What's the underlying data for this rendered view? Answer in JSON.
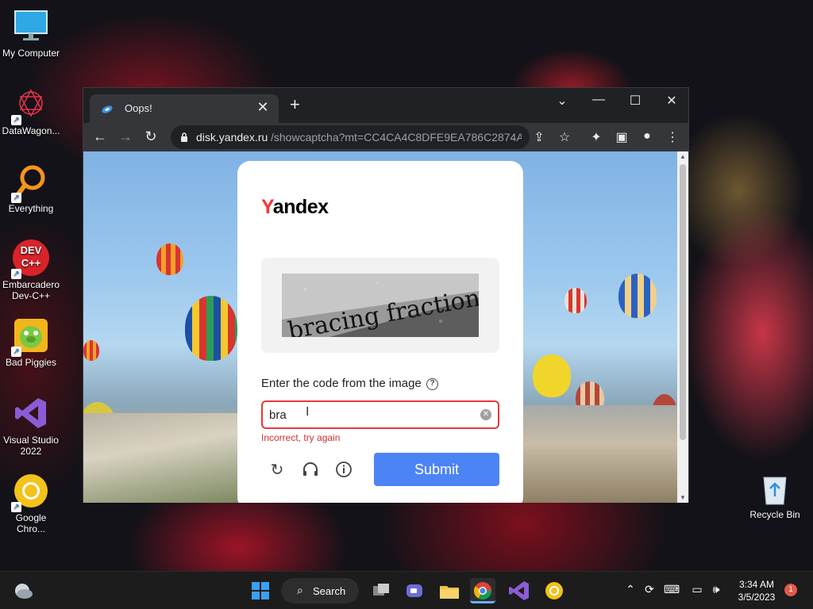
{
  "desktop_icons": [
    {
      "label": "My Computer",
      "icon": "monitor-icon"
    },
    {
      "label": "DataWagon...",
      "icon": "datawagon-icon"
    },
    {
      "label": "Everything",
      "icon": "everything-search-icon"
    },
    {
      "label": "Embarcadero Dev-C++",
      "icon": "devcpp-icon",
      "badge": "DEV C++"
    },
    {
      "label": "Bad Piggies",
      "icon": "bad-piggies-icon"
    },
    {
      "label": "Visual Studio 2022",
      "icon": "visual-studio-icon"
    },
    {
      "label": "Google Chro...",
      "icon": "chrome-icon"
    }
  ],
  "recycle_bin": {
    "label": "Recycle Bin"
  },
  "browser": {
    "tab_title": "Oops!",
    "tab_close": "✕",
    "new_tab": "+",
    "url_host": "disk.yandex.ru",
    "url_path": "/showcaptcha?mt=CC4CA4C8DFE9EA786C2874AB...",
    "controls": {
      "dropdown": "⌄",
      "minimize": "—",
      "maximize": "☐",
      "close": "✕"
    }
  },
  "captcha": {
    "logo_first": "Y",
    "logo_rest": "andex",
    "captcha_text": "bracing fraction",
    "prompt": "Enter the code from the image",
    "help": "?",
    "input_value": "bra",
    "error": "Incorrect, try again",
    "submit_label": "Submit"
  },
  "taskbar": {
    "search_label": "Search",
    "clock_time": "3:34 AM",
    "clock_date": "3/5/2023",
    "notifications": "1"
  },
  "colors": {
    "submit": "#4c84f6",
    "error": "#e53935",
    "yandex_red": "#ff3333",
    "browser_dark": "#202124"
  }
}
